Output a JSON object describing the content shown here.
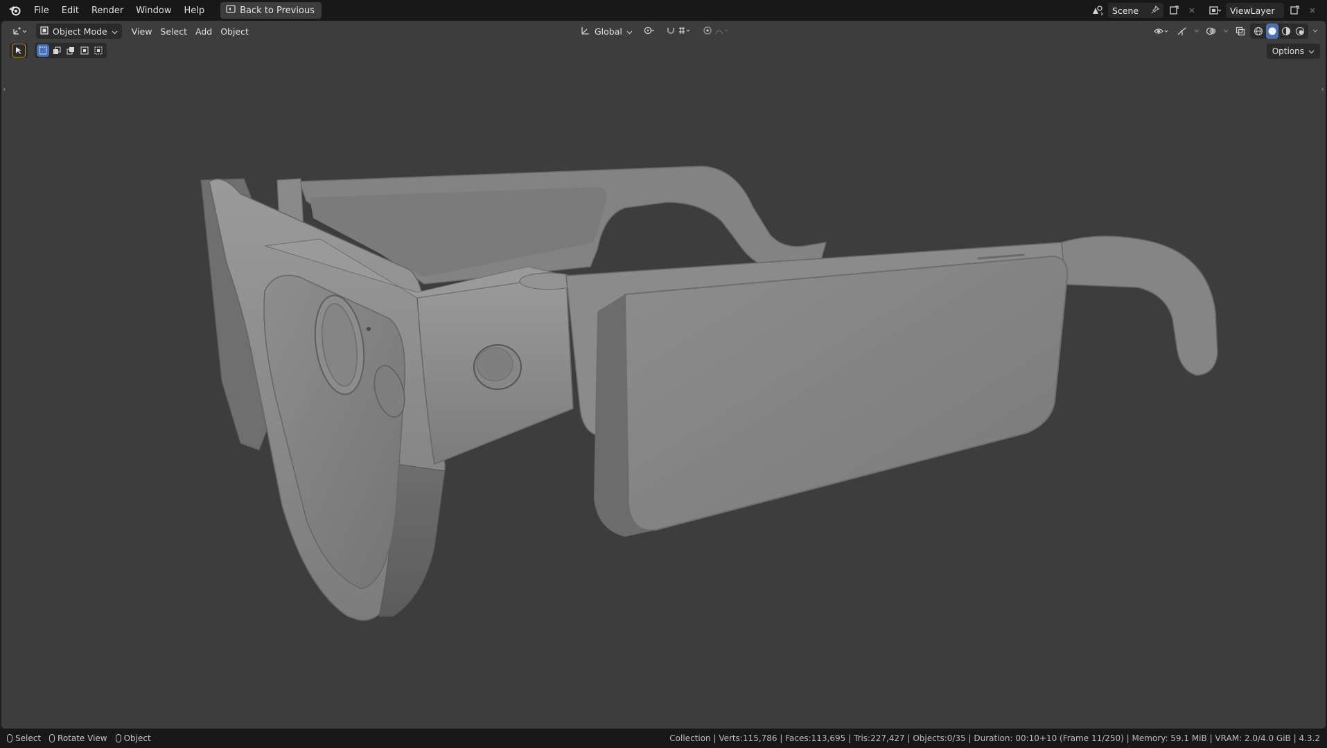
{
  "menu": {
    "items": [
      "File",
      "Edit",
      "Render",
      "Window",
      "Help"
    ],
    "back_label": "Back to Previous"
  },
  "topright": {
    "scene_label": "Scene",
    "viewlayer_label": "ViewLayer"
  },
  "viewport_header": {
    "mode_label": "Object Mode",
    "menus": [
      "View",
      "Select",
      "Add",
      "Object"
    ],
    "transform_orientation": "Global",
    "options_label": "Options"
  },
  "status": {
    "hints": [
      "Select",
      "Rotate View",
      "Object"
    ],
    "stats": "Collection | Verts:115,786 | Faces:113,695 | Tris:227,427 | Objects:0/35 | Duration: 00:10+10 (Frame 11/250) | Memory: 59.1 MiB | VRAM: 2.0/4.0 GiB | 4.3.2"
  },
  "colors": {
    "viewport_bg": "#3d3d3d",
    "bar_bg": "#181818",
    "accent_active": "#4772b3",
    "model_fill": "#8a8a8a"
  }
}
